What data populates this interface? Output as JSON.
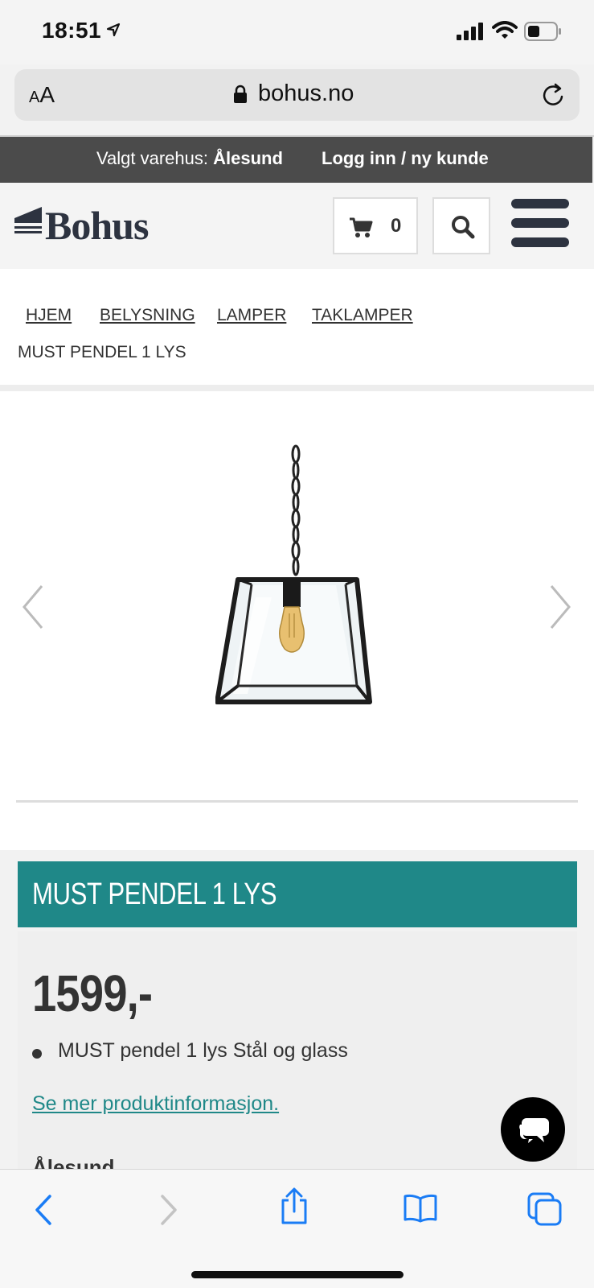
{
  "status_bar": {
    "time": "18:51",
    "icons": [
      "location-arrow-icon",
      "cellular-signal-icon",
      "wifi-icon",
      "battery-icon"
    ]
  },
  "browser": {
    "text_size_label": "AA",
    "url": "bohus.no",
    "icons": [
      "lock-icon",
      "reload-icon"
    ]
  },
  "store_bar": {
    "store_prefix": "Valgt varehus: ",
    "store_name": "Ålesund",
    "login_label": "Logg inn / ny kunde"
  },
  "header": {
    "logo_text": "Bohus",
    "cart_count": "0",
    "icons": [
      "cart-icon",
      "search-icon",
      "hamburger-menu-icon"
    ]
  },
  "breadcrumb": {
    "items": [
      "HJEM",
      "BELYSNING",
      "LAMPER",
      "TAKLAMPER"
    ],
    "current": "MUST PENDEL 1 LYS"
  },
  "product": {
    "title": "MUST PENDEL 1 LYS",
    "price": "1599,-",
    "features": [
      "MUST pendel 1 lys Stål og glass"
    ],
    "more_info_link": "Se mer produktinformasjon.",
    "store_heading": "Ålesund"
  },
  "colors": {
    "accent_teal": "#1f8888",
    "dark_strip": "#4b4b4b",
    "logo_navy": "#2d3340",
    "ios_blue": "#1a7cf5"
  },
  "toolbar": {
    "icons": [
      "back-icon",
      "forward-icon",
      "share-icon",
      "bookmarks-icon",
      "tabs-icon"
    ]
  }
}
